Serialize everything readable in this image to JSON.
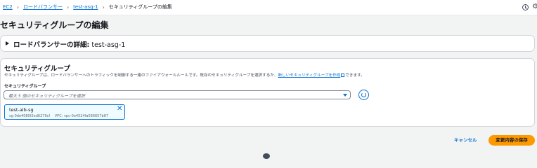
{
  "breadcrumb": {
    "items": [
      "EC2",
      "ロードバランサー",
      "test-asg-1"
    ],
    "current": "セキュリティグループの編集"
  },
  "page": {
    "title": "セキュリティグループの編集"
  },
  "details_panel": {
    "label": "ロードバランサーの詳細:",
    "value": "test-asg-1"
  },
  "security_group_panel": {
    "heading": "セキュリティグループ",
    "description": "セキュリティグループは、ロードバランサーへのトラフィックを制御する一連のファイアウォールルールです。既存のセキュリティグループを選択するか、",
    "create_link": "新しいセキュリティグループを作成",
    "description_suffix": "できます。",
    "field_label": "セキュリティグループ",
    "select_placeholder": "最大 5 個のセキュリティグループを選択"
  },
  "selected_groups": [
    {
      "name": "test-alb-sg",
      "id": "sg-0de4080f2ed6279cf",
      "vpc": "VPC: vpc-0e4524fa586657b87"
    }
  ],
  "footer": {
    "cancel_label": "キャンセル",
    "save_label": "変更内容の保存"
  },
  "colors": {
    "accent": "#0972d3",
    "primary_button": "#ff9900",
    "background": "#f2f3f3"
  },
  "icons": [
    "chevron-right-icon",
    "clock-icon",
    "settings-icon",
    "caret-right-icon",
    "external-link-icon",
    "caret-down-icon",
    "refresh-icon",
    "close-icon"
  ]
}
